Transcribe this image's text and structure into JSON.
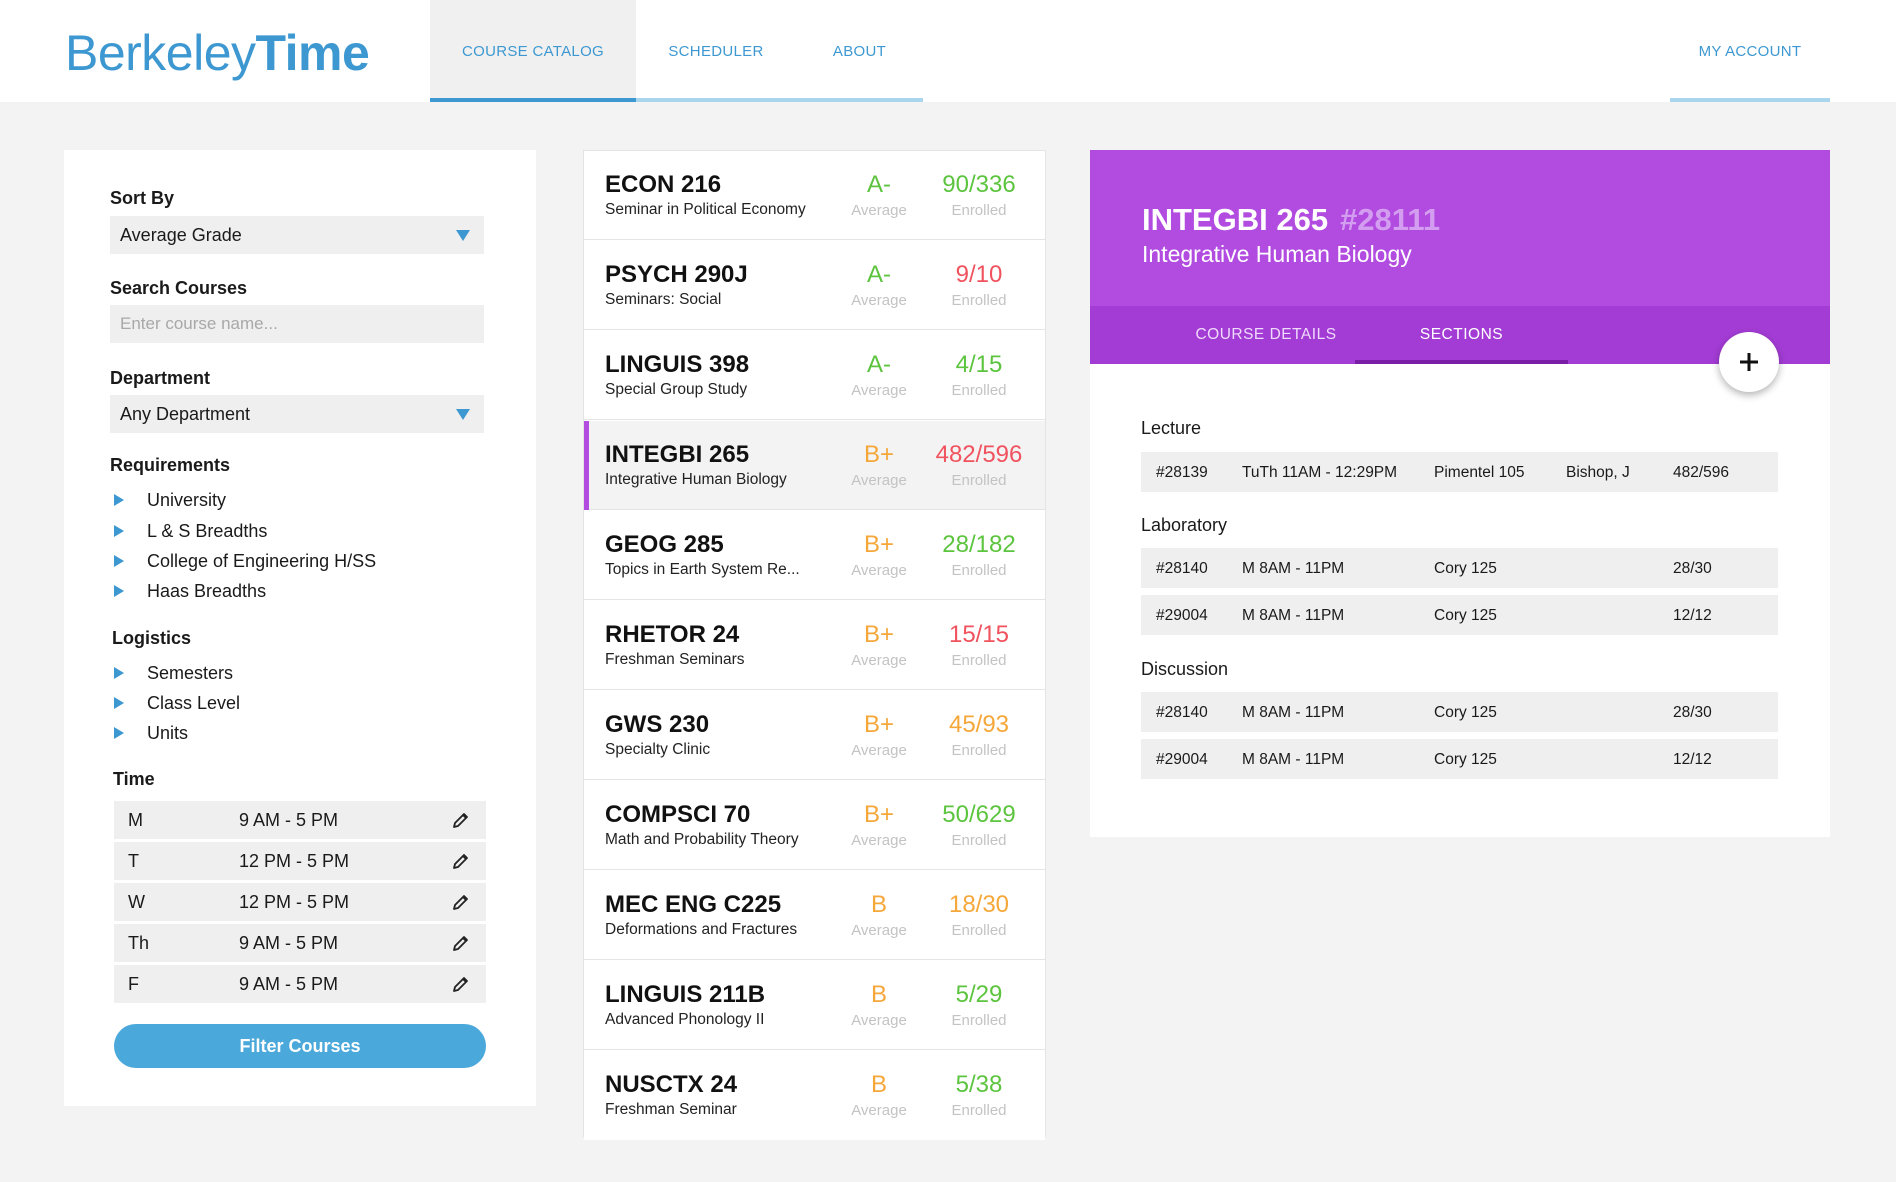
{
  "header": {
    "logo_regular": "Berkeley",
    "logo_bold": "Time",
    "nav": {
      "course_catalog": "COURSE CATALOG",
      "scheduler": "SCHEDULER",
      "about": "ABOUT",
      "my_account": "MY ACCOUNT"
    },
    "active_tab": "COURSE CATALOG"
  },
  "filters": {
    "sort_by_label": "Sort By",
    "sort_by_value": "Average Grade",
    "search_label": "Search Courses",
    "search_placeholder": "Enter course name...",
    "department_label": "Department",
    "department_value": "Any Department",
    "requirements_label": "Requirements",
    "requirements": [
      "University",
      "L & S Breadths",
      "College of Engineering H/SS",
      "Haas Breadths"
    ],
    "logistics_label": "Logistics",
    "logistics": [
      "Semesters",
      "Class Level",
      "Units"
    ],
    "time_label": "Time",
    "times": [
      {
        "day": "M",
        "range": "9 AM - 5 PM"
      },
      {
        "day": "T",
        "range": "12 PM - 5 PM"
      },
      {
        "day": "W",
        "range": "12 PM - 5 PM"
      },
      {
        "day": "Th",
        "range": "9 AM - 5 PM"
      },
      {
        "day": "F",
        "range": "9 AM - 5 PM"
      }
    ],
    "filter_button": "Filter Courses"
  },
  "courses": [
    {
      "code": "ECON 216",
      "title": "Seminar in Political Economy",
      "grade": "A-",
      "grade_color": "#5cc43e",
      "enrolled": "90/336",
      "enrolled_color": "#5cc43e",
      "grade_sub": "Average",
      "enrolled_sub": "Enrolled"
    },
    {
      "code": "PSYCH 290J",
      "title": "Seminars: Social",
      "grade": "A-",
      "grade_color": "#5cc43e",
      "enrolled": "9/10",
      "enrolled_color": "#f0525e",
      "grade_sub": "Average",
      "enrolled_sub": "Enrolled"
    },
    {
      "code": "LINGUIS 398",
      "title": "Special Group Study",
      "grade": "A-",
      "grade_color": "#5cc43e",
      "enrolled": "4/15",
      "enrolled_color": "#5cc43e",
      "grade_sub": "Average",
      "enrolled_sub": "Enrolled"
    },
    {
      "code": "INTEGBI 265",
      "title": "Integrative Human Biology",
      "grade": "B+",
      "grade_color": "#f5a73a",
      "enrolled": "482/596",
      "enrolled_color": "#f0525e",
      "grade_sub": "Average",
      "enrolled_sub": "Enrolled"
    },
    {
      "code": "GEOG 285",
      "title": "Topics in Earth System Re...",
      "grade": "B+",
      "grade_color": "#f5a73a",
      "enrolled": "28/182",
      "enrolled_color": "#5cc43e",
      "grade_sub": "Average",
      "enrolled_sub": "Enrolled"
    },
    {
      "code": "RHETOR 24",
      "title": "Freshman Seminars",
      "grade": "B+",
      "grade_color": "#f5a73a",
      "enrolled": "15/15",
      "enrolled_color": "#f0525e",
      "grade_sub": "Average",
      "enrolled_sub": "Enrolled"
    },
    {
      "code": "GWS 230",
      "title": "Specialty Clinic",
      "grade": "B+",
      "grade_color": "#f5a73a",
      "enrolled": "45/93",
      "enrolled_color": "#f5a73a",
      "grade_sub": "Average",
      "enrolled_sub": "Enrolled"
    },
    {
      "code": "COMPSCI 70",
      "title": "Math and Probability Theory",
      "grade": "B+",
      "grade_color": "#f5a73a",
      "enrolled": "50/629",
      "enrolled_color": "#5cc43e",
      "grade_sub": "Average",
      "enrolled_sub": "Enrolled"
    },
    {
      "code": "MEC ENG C225",
      "title": "Deformations and Fractures",
      "grade": "B",
      "grade_color": "#f5a73a",
      "enrolled": "18/30",
      "enrolled_color": "#f5a73a",
      "grade_sub": "Average",
      "enrolled_sub": "Enrolled"
    },
    {
      "code": "LINGUIS 211B",
      "title": "Advanced Phonology II",
      "grade": "B",
      "grade_color": "#f5a73a",
      "enrolled": "5/29",
      "enrolled_color": "#5cc43e",
      "grade_sub": "Average",
      "enrolled_sub": "Enrolled"
    },
    {
      "code": "NUSCTX 24",
      "title": "Freshman Seminar",
      "grade": "B",
      "grade_color": "#f5a73a",
      "enrolled": "5/38",
      "enrolled_color": "#5cc43e",
      "grade_sub": "Average",
      "enrolled_sub": "Enrolled"
    }
  ],
  "selected_course": "INTEGBI 265",
  "detail": {
    "code": "INTEGBI 265",
    "ccn": "#28111",
    "name": "Integrative Human Biology",
    "tabs": {
      "details": "COURSE DETAILS",
      "sections": "SECTIONS"
    },
    "active_tab": "SECTIONS",
    "sections": {
      "lecture_label": "Lecture",
      "lecture": [
        {
          "id": "#28139",
          "time": "TuTh 11AM - 12:29PM",
          "location": "Pimentel 105",
          "instructor": "Bishop, J",
          "enrolled": "482/596"
        }
      ],
      "lab_label": "Laboratory",
      "lab": [
        {
          "id": "#28140",
          "time": "M 8AM - 11PM",
          "location": "Cory 125",
          "instructor": "",
          "enrolled": "28/30"
        },
        {
          "id": "#29004",
          "time": "M 8AM - 11PM",
          "location": "Cory 125",
          "instructor": "",
          "enrolled": "12/12"
        }
      ],
      "discussion_label": "Discussion",
      "discussion": [
        {
          "id": "#28140",
          "time": "M 8AM - 11PM",
          "location": "Cory 125",
          "instructor": "",
          "enrolled": "28/30"
        },
        {
          "id": "#29004",
          "time": "M 8AM - 11PM",
          "location": "Cory 125",
          "instructor": "",
          "enrolled": "12/12"
        }
      ]
    }
  },
  "colors": {
    "brand_blue": "#3d98d1",
    "purple": "#b24ce0",
    "green": "#5cc43e",
    "orange": "#f5a73a",
    "red": "#f0525e"
  },
  "icons": {
    "caret": "caret-down-icon",
    "tree": "triangle-right-icon",
    "edit": "pencil-icon",
    "add": "plus-icon"
  }
}
